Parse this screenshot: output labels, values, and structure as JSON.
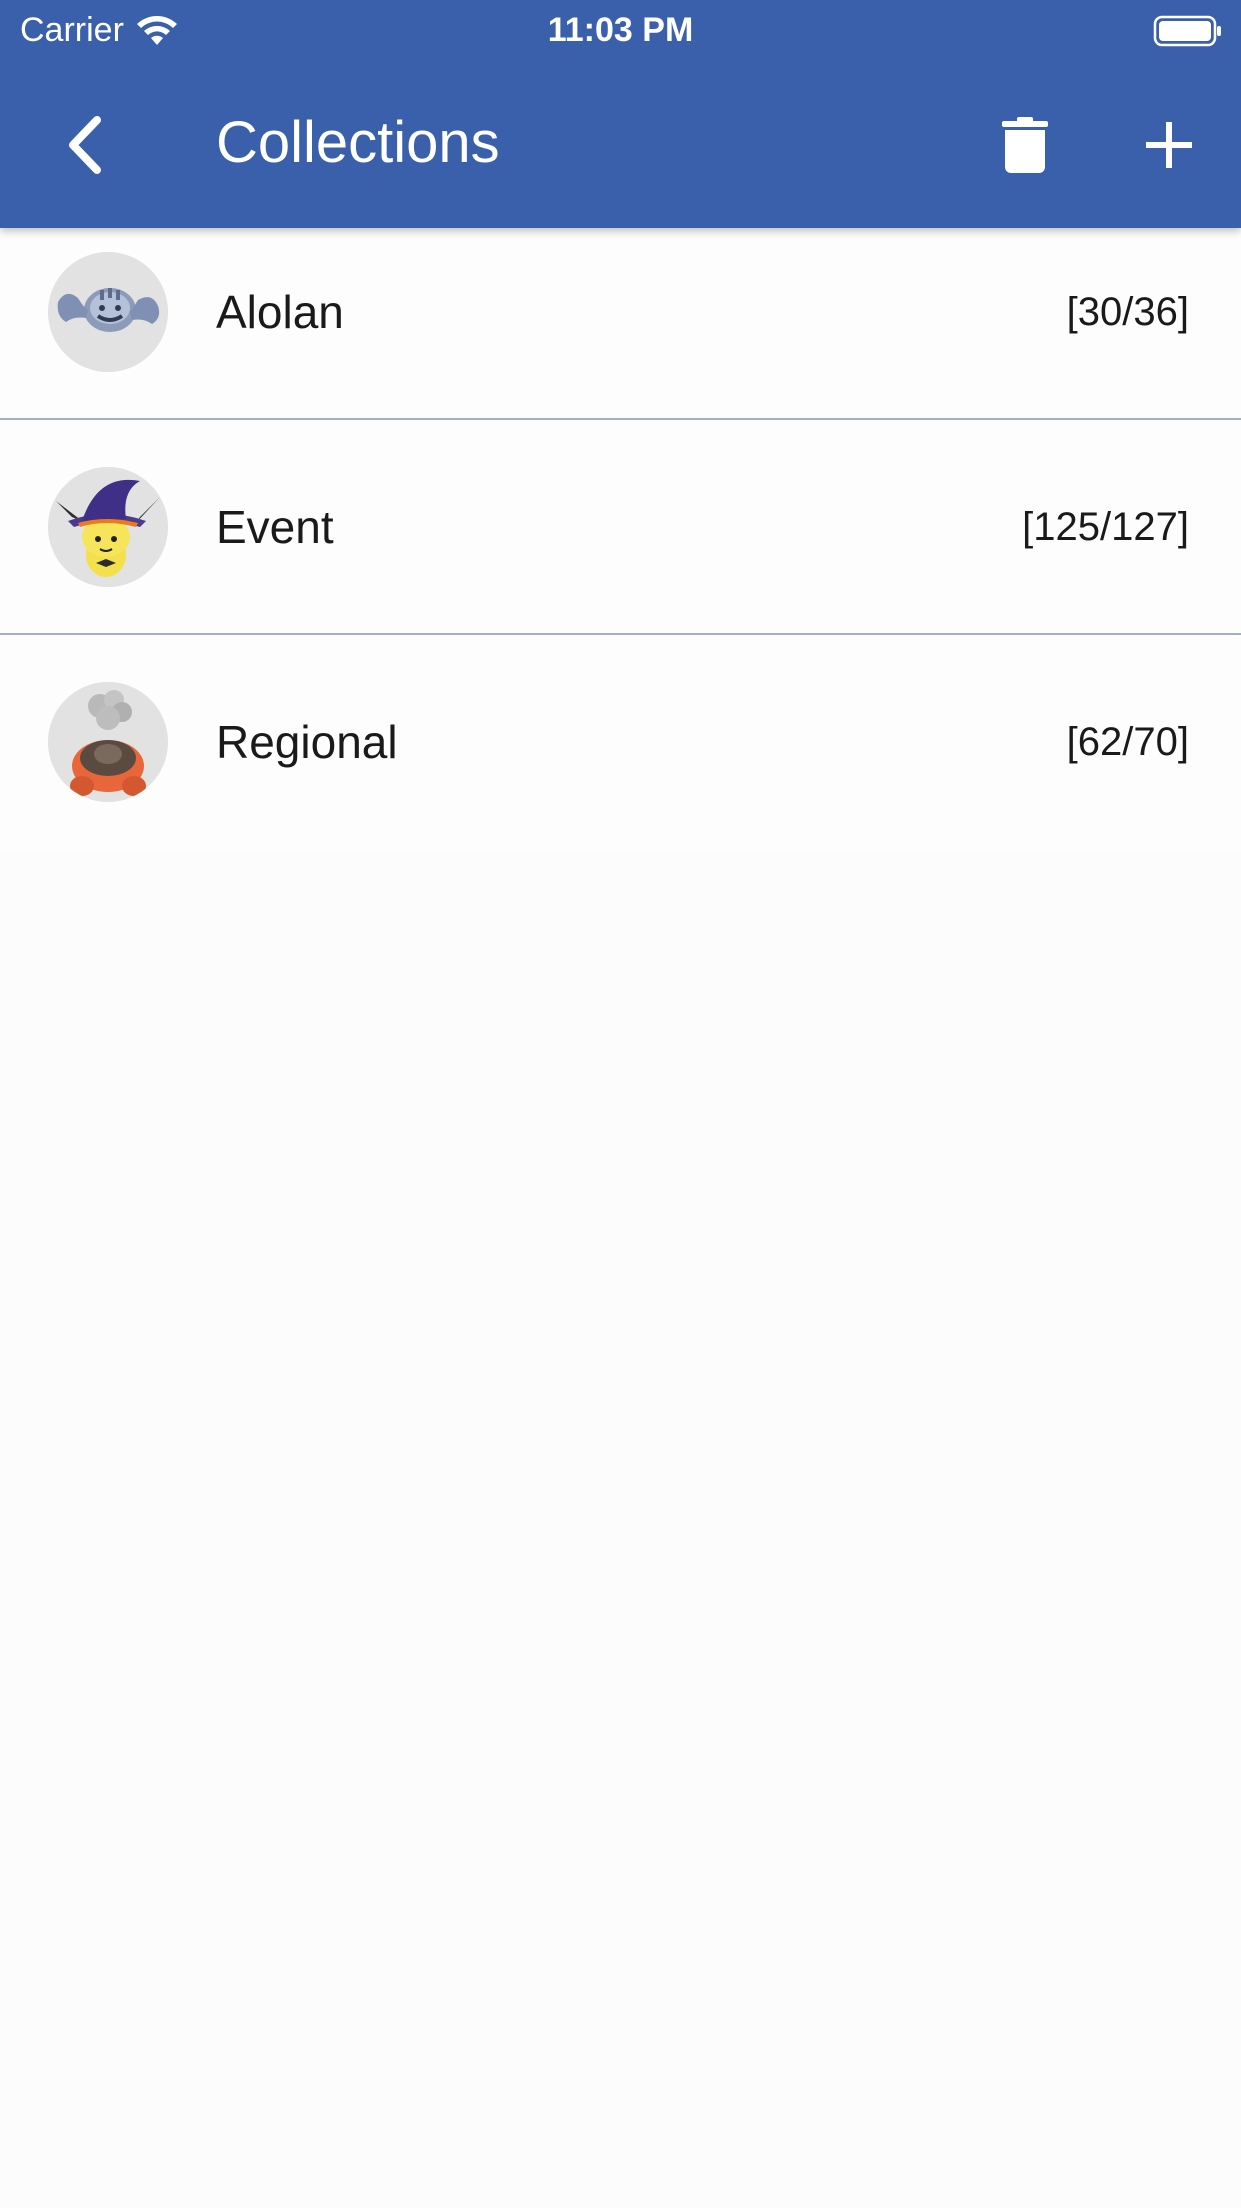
{
  "status_bar": {
    "carrier": "Carrier",
    "time": "11:03 PM",
    "wifi_icon": "wifi-icon",
    "battery_icon": "battery-full-icon"
  },
  "app_bar": {
    "title": "Collections",
    "back_icon": "chevron-left-icon",
    "trash_icon": "trash-icon",
    "add_icon": "plus-icon",
    "background_color": "#3a60ab"
  },
  "collections": [
    {
      "name": "Alolan",
      "count": "[30/36]",
      "avatar": "alolan-geodude-avatar"
    },
    {
      "name": "Event",
      "count": "[125/127]",
      "avatar": "witch-hat-pichu-avatar"
    },
    {
      "name": "Regional",
      "count": "[62/70]",
      "avatar": "torkoal-avatar"
    }
  ],
  "colors": {
    "divider": "#9fb0c8",
    "background": "#fcfcfc"
  }
}
